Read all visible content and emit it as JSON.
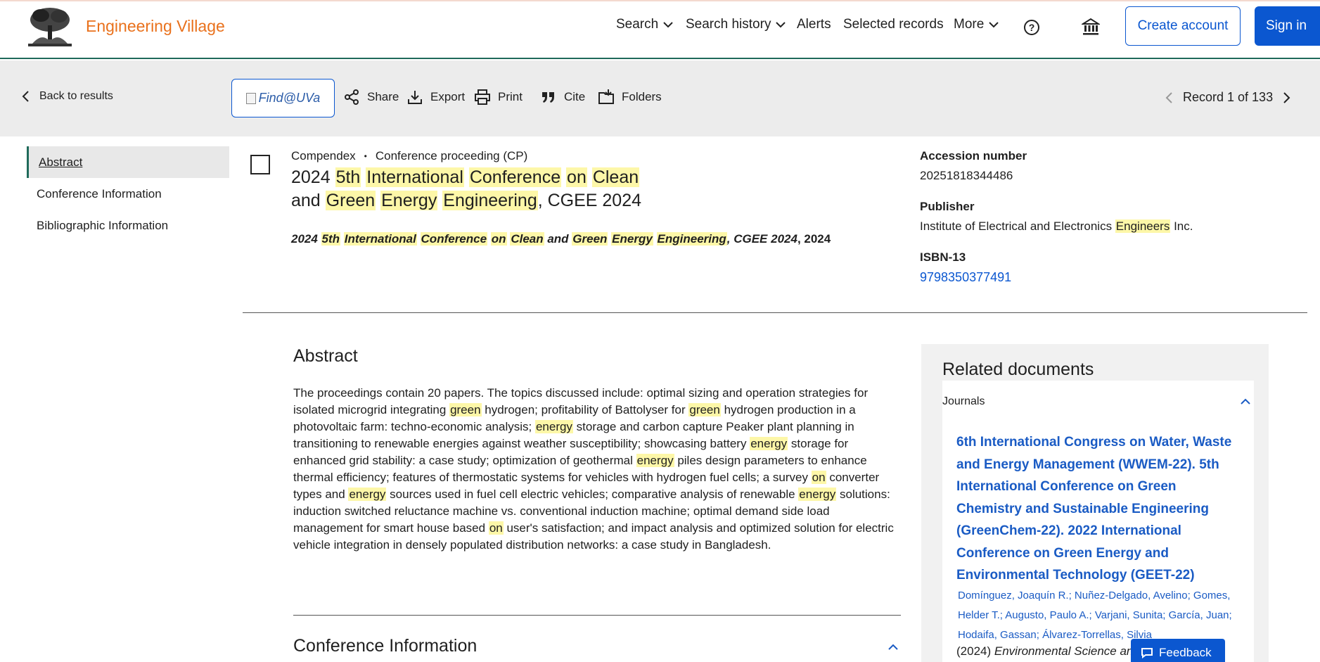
{
  "header": {
    "brand": "Engineering Village",
    "nav": {
      "search": "Search",
      "search_history": "Search history",
      "alerts": "Alerts",
      "selected_records": "Selected records",
      "more": "More"
    },
    "help_glyph": "?",
    "create_account": "Create account",
    "sign_in": "Sign in"
  },
  "toolbar": {
    "back": "Back to results",
    "find": "Find@UVa",
    "share": "Share",
    "export": "Export",
    "print": "Print",
    "cite": "Cite",
    "folders": "Folders",
    "record_position": "Record 1 of 133"
  },
  "left_nav": {
    "abstract": "Abstract",
    "conference_information": "Conference Information",
    "bibliographic_information": "Bibliographic Information"
  },
  "record": {
    "database": "Compendex",
    "doc_type": "Conference proceeding (CP)",
    "dot": "•",
    "title_parts": {
      "p1": "2024 ",
      "h1": "5th",
      "p2": " ",
      "h2": "International",
      "p3": " ",
      "h3": "Conference",
      "p4": " ",
      "h4": "on",
      "p5": " ",
      "h5": "Clean",
      "p6": " and ",
      "h6": "Green",
      "p7": " ",
      "h7": "Energy",
      "p8": " ",
      "h8": "Engineering",
      "p9": ", CGEE 2024"
    },
    "conference_year": "2024"
  },
  "side_meta": {
    "accession_label": "Accession number",
    "accession_value": "20251818344486",
    "publisher_label": "Publisher",
    "publisher_pre": "Institute of Electrical and Electronics ",
    "publisher_mark": "Engineers",
    "publisher_post": " Inc.",
    "isbn_label": "ISBN-13",
    "isbn_value": "9798350377491"
  },
  "abstract": {
    "heading": "Abstract",
    "s1": "The proceedings contain 20 papers. The topics discussed include: optimal sizing and operation strategies for isolated microgrid integrating ",
    "m1": "green",
    "s2": " hydrogen; profitability of Battolyser for ",
    "m2": "green",
    "s3": " hydrogen production in a photovoltaic farm: techno-economic analysis; ",
    "m3": "energy",
    "s4": " storage and carbon capture Peaker plant planning in transitioning to renewable energies against weather susceptibility; showcasing battery ",
    "m4": "energy",
    "s5": " storage for enhanced grid stability: a case study; optimization of geothermal ",
    "m5": "energy",
    "s6": " piles design parameters to enhance thermal efficiency; features of thermostatic systems for vehicles with hydrogen fuel cells; a survey ",
    "m6": "on",
    "s7": " converter types and ",
    "m7": "energy",
    "s8": " sources used in fuel cell electric vehicles; comparative analysis of renewable ",
    "m8": "energy",
    "s9": " solutions: induction switched reluctance machine vs. conventional induction machine; optimal demand side load management for smart house based ",
    "m9": "on",
    "s10": " user's satisfaction; and impact analysis and optimized solution for electric vehicle integration in densely populated distribution networks: a case study in Bangladesh."
  },
  "conference_section": {
    "heading": "Conference Information"
  },
  "related": {
    "heading": "Related documents",
    "tab": "Journals",
    "doc_title": "6th International Congress on Water, Waste and Energy Management (WWEM-22). 5th International Conference on Green Chemistry and Sustainable Engineering (GreenChem-22). 2022 International Conference on Green Energy and Environmental Technology (GEET-22)",
    "authors": "Domínguez, Joaquín R.; Nuñez-Delgado, Avelino; Gomes, Helder T.; Augusto, Paulo A.; Varjani, Sunita; García, Juan; Hodaifa, Gassan; Álvarez-Torrellas, Silvia",
    "year": "(2024) ",
    "journal": "Environmental Science an"
  },
  "feedback": "Feedback",
  "colors": {
    "brand_orange": "#e9711c",
    "primary_blue": "#0b57d0",
    "highlight": "#fdf7a8",
    "header_rule": "#1f6a5a"
  }
}
